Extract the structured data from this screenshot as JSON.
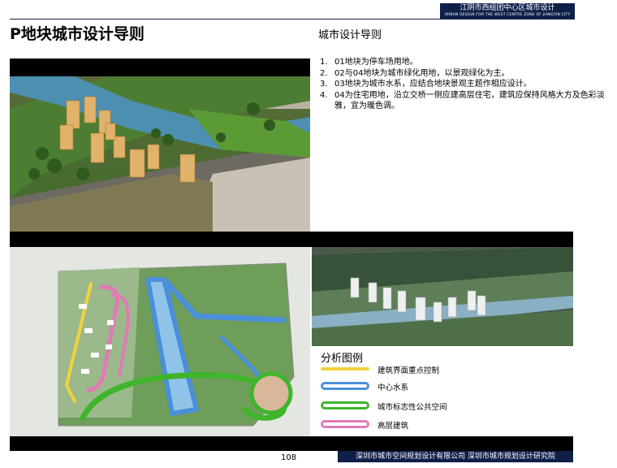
{
  "header": {
    "title_cn": "江阴市西组团中心区城市设计",
    "title_en": "URBAN DESIGN FOR THE WEST CENTRE ZONE OF JIANGYIN CITY"
  },
  "page_title": "P地块城市设计导则",
  "guidelines": {
    "heading": "城市设计导则",
    "items": [
      {
        "num": "1.",
        "text": "01地块为停车场用地。"
      },
      {
        "num": "2.",
        "text": "02与04地块为城市绿化用地，以景观绿化为主。"
      },
      {
        "num": "3.",
        "text": "03地块为城市水系，应结合地块景观主题作相应设计。"
      },
      {
        "num": "4.",
        "text": "04为住宅用地，沿立交桥一侧应建高层住宅，建筑应保持风格大方及色彩淡雅，宜为暖色调。"
      }
    ]
  },
  "legend": {
    "heading": "分析图例",
    "items": [
      {
        "label": "建筑界面重点控制",
        "color": "#f2d23a",
        "style": "filled"
      },
      {
        "label": "中心水系",
        "color": "#4a8fd8",
        "style": "outline"
      },
      {
        "label": "城市标志性公共空间",
        "color": "#3fb52c",
        "style": "outline"
      },
      {
        "label": "高层建筑",
        "color": "#e07ab8",
        "style": "outline"
      }
    ]
  },
  "footer": {
    "org": "深圳市城市空间规划设计有限公司  深圳市城市规划设计研究院",
    "page_number": "108"
  }
}
